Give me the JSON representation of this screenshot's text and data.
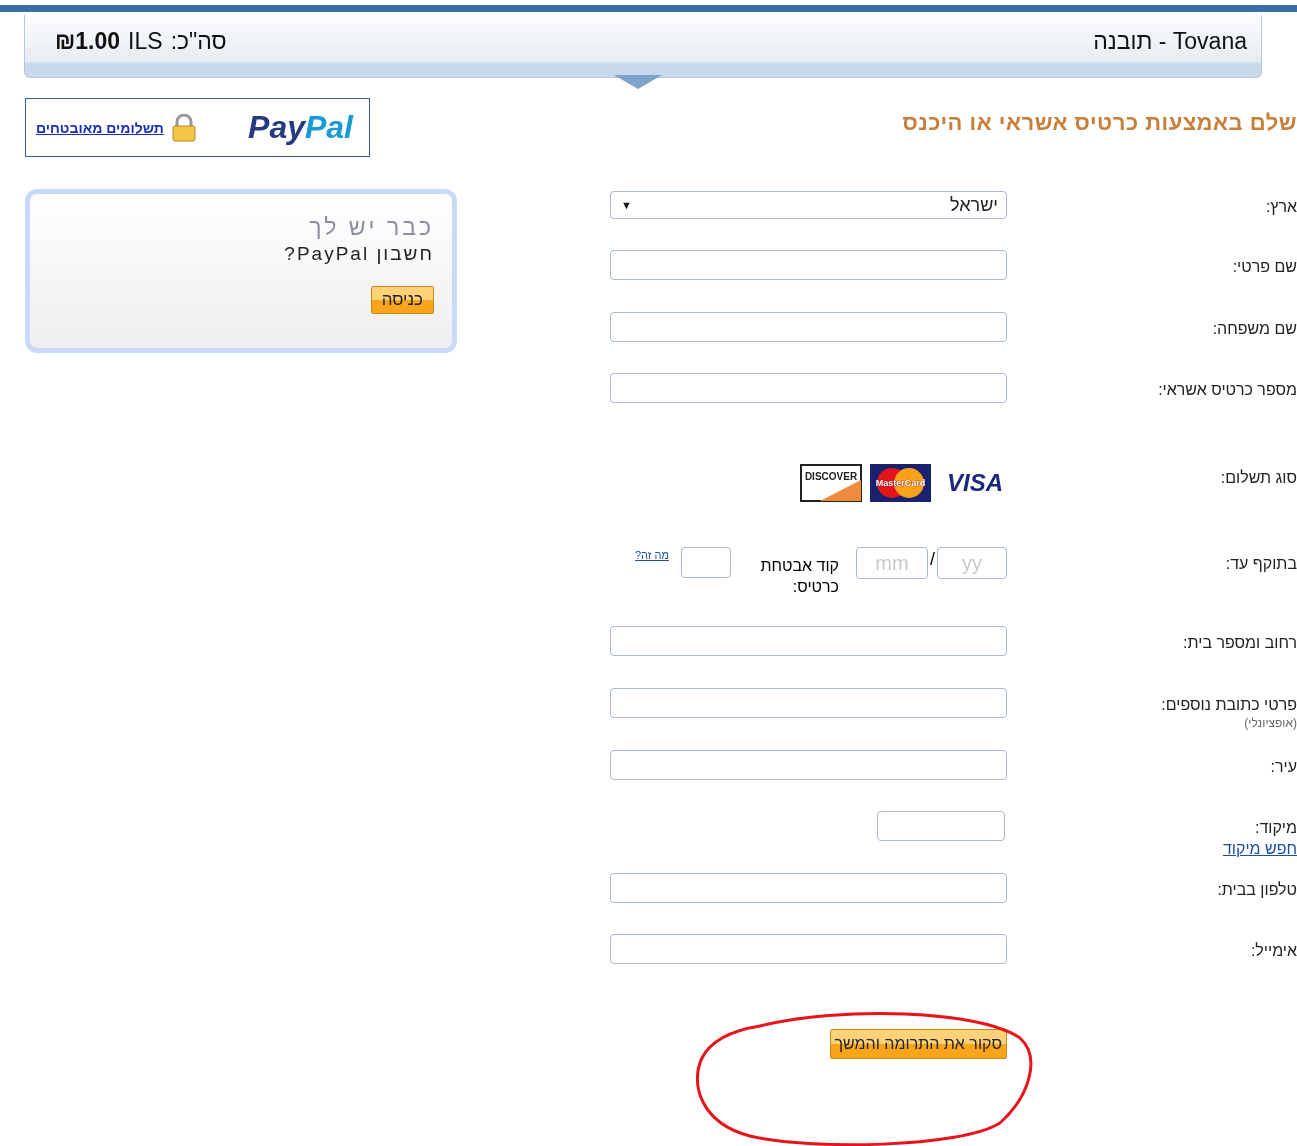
{
  "header": {
    "title": "Tovana - תובנה",
    "total_label": "סה\"כ:",
    "currency": "ILS",
    "amount": "₪1.00"
  },
  "heading": "שלם באמצעות כרטיס אשראי או היכנס",
  "paypal_badge": {
    "logo": "PayPal",
    "link": "תשלומים מאובטחים"
  },
  "login_card": {
    "line_1": "כבר יש לך",
    "line_2": "חשבון PayPal?",
    "button": "כניסה"
  },
  "rows": [
    {
      "kind": "select",
      "label": "ארץ:",
      "value": "ישראל",
      "caret": "▼"
    },
    {
      "kind": "text",
      "label": "שם פרטי:"
    },
    {
      "kind": "text",
      "label": "שם משפחה:"
    },
    {
      "kind": "text",
      "label": "מספר כרטיס אשראי:"
    },
    {
      "kind": "cards",
      "label": "סוג תשלום:",
      "cards": [
        {
          "kind": "visa",
          "text": "VISA"
        },
        {
          "kind": "mastercard",
          "text": "MasterCard"
        },
        {
          "kind": "discover",
          "text": "DISCOVER"
        }
      ]
    },
    {
      "kind": "expiry",
      "label": "בתוקף עד:",
      "year_placeholder": "yy",
      "separator": "/",
      "month_placeholder": "mm",
      "cvv_label": "קוד אבטחת כרטיס:",
      "cvv_link": "מה זה?"
    },
    {
      "kind": "text",
      "label": "רחוב ומספר בית:"
    },
    {
      "kind": "text",
      "label": "פרטי כתובת נוספים:",
      "note": "(אופציונלי)"
    },
    {
      "kind": "text",
      "label": "עיר:"
    },
    {
      "kind": "zip",
      "label": "מיקוד:",
      "link": "חפש מיקוד"
    },
    {
      "kind": "text",
      "label": "טלפון בבית:"
    },
    {
      "kind": "text",
      "label": "אימייל:"
    }
  ],
  "submit": "סקור את התרומה והמשך"
}
